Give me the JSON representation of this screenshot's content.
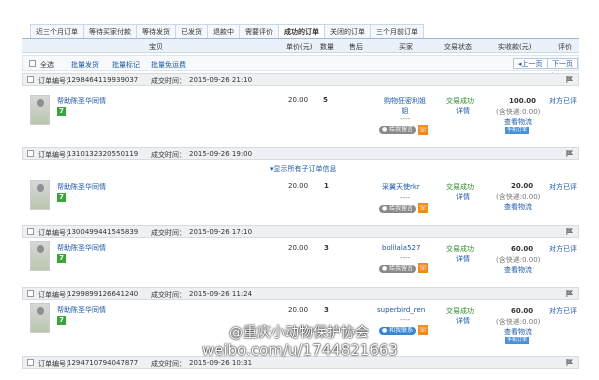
{
  "tabs": [
    "近三个月订单",
    "等待买家付款",
    "等待发货",
    "已发货",
    "退款中",
    "需要评价",
    "成功的订单",
    "关闭的订单",
    "三个月前订单"
  ],
  "header": {
    "item": "宝贝",
    "price": "单价(元)",
    "qty": "数量",
    "after": "售后",
    "buyer": "买家",
    "status": "交易状态",
    "paid": "实收款(元)",
    "review": "评价"
  },
  "batch": {
    "select_all": "全选",
    "batch_ship": "批量发货",
    "batch_mark": "批量标记",
    "batch_free": "批量免运费",
    "prev": "上一页",
    "next": "下一页"
  },
  "orders": [
    {
      "no_label": "订单编号：",
      "no": "1298464119939037",
      "time_label": "成交时间：",
      "time": "2015-09-26 21:10",
      "product": "帮助陈圣华同情",
      "price": "20.00",
      "qty": "5",
      "buyer": "购物狂密利姐姐",
      "status": "交易成功",
      "detail": "详情",
      "amount": "100.00",
      "shipping": "(含快递:0.00)",
      "logistics": "查看物流",
      "review": "对方已评",
      "msg_btn": "给我留言",
      "tag": "手机订单",
      "extra": ""
    },
    {
      "no_label": "订单编号：",
      "no": "1310132320550119",
      "time_label": "成交时间：",
      "time": "2015-09-26 19:00",
      "product": "帮助陈圣华同情",
      "price": "20.00",
      "qty": "1",
      "buyer": "采翼天使rkr",
      "status": "交易成功",
      "detail": "详情",
      "amount": "20.00",
      "shipping": "(含快递:0.00)",
      "logistics": "查看物流",
      "review": "对方已评",
      "msg_btn": "给我留言",
      "tag": "",
      "extra": "显示所有子订单信息"
    },
    {
      "no_label": "订单编号：",
      "no": "1300499441545839",
      "time_label": "成交时间：",
      "time": "2015-09-26 17:10",
      "product": "帮助陈圣华同情",
      "price": "20.00",
      "qty": "3",
      "buyer": "bolilala527",
      "status": "交易成功",
      "detail": "详情",
      "amount": "60.00",
      "shipping": "(含快递:0.00)",
      "logistics": "查看物流",
      "review": "对方已评",
      "msg_btn": "给我留言",
      "tag": "",
      "extra": ""
    },
    {
      "no_label": "订单编号：",
      "no": "1299899126641240",
      "time_label": "成交时间：",
      "time": "2015-09-26 11:24",
      "product": "帮助陈圣华同情",
      "price": "20.00",
      "qty": "3",
      "buyer": "superbird_ren",
      "status": "交易成功",
      "detail": "详情",
      "amount": "60.00",
      "shipping": "(含快递:0.00)",
      "logistics": "查看物流",
      "review": "对方已评",
      "msg_btn": "和我联系",
      "tag": "手机订单",
      "extra": ""
    },
    {
      "no_label": "订单编号：",
      "no": "1294710794047877",
      "time_label": "成交时间：",
      "time": "2015-09-26 10:31",
      "product": "",
      "price": "",
      "qty": "",
      "buyer": "",
      "status": "",
      "detail": "",
      "amount": "",
      "shipping": "",
      "logistics": "",
      "review": "",
      "msg_btn": "",
      "tag": "",
      "extra": ""
    }
  ],
  "watermark": {
    "line1": "@重庆小动物保护协会",
    "line2": "weibo.com/u/1744821663"
  },
  "colors": {
    "link": "#1d57a7",
    "status": "#2b8a2b",
    "header_bg": "#eaf1f9",
    "phone": "#f08a1c",
    "quality_tag": "#3aa63a"
  }
}
